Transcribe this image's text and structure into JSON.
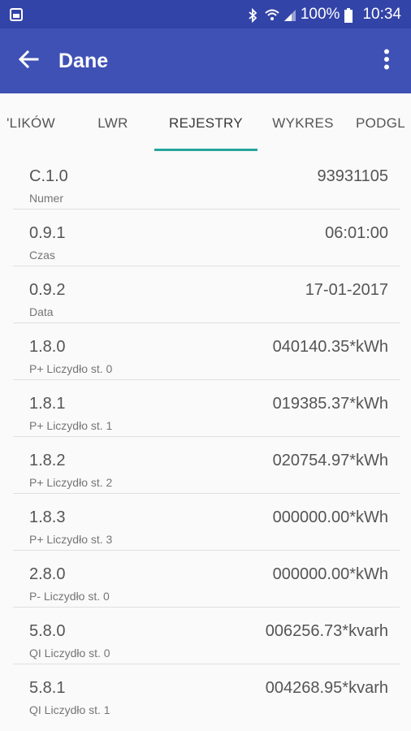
{
  "status_bar": {
    "battery_text": "100%",
    "time": "10:34"
  },
  "app_bar": {
    "title": "Dane",
    "back_icon": "arrow-back-icon",
    "menu_icon": "more-vert-icon"
  },
  "tabs": [
    {
      "label": "PLIKÓW",
      "visible_text": "'LIKÓW",
      "active": false
    },
    {
      "label": "LWR",
      "visible_text": "LWR",
      "active": false
    },
    {
      "label": "REJESTRY",
      "visible_text": "REJESTRY",
      "active": true
    },
    {
      "label": "WYKRES",
      "visible_text": "WYKRES",
      "active": false
    },
    {
      "label": "PODGLĄD",
      "visible_text": "PODGL",
      "active": false
    }
  ],
  "colors": {
    "primary": "#3f51b5",
    "status_bar": "#3344a8",
    "tab_indicator": "#26a69a"
  },
  "registers": [
    {
      "code": "C.1.0",
      "description": "Numer",
      "value": "93931105"
    },
    {
      "code": "0.9.1",
      "description": "Czas",
      "value": "06:01:00"
    },
    {
      "code": "0.9.2",
      "description": "Data",
      "value": "17-01-2017"
    },
    {
      "code": "1.8.0",
      "description": "P+ Liczydło st. 0",
      "value": "040140.35*kWh"
    },
    {
      "code": "1.8.1",
      "description": "P+ Liczydło st. 1",
      "value": "019385.37*kWh"
    },
    {
      "code": "1.8.2",
      "description": "P+ Liczydło st. 2",
      "value": "020754.97*kWh"
    },
    {
      "code": "1.8.3",
      "description": "P+ Liczydło st. 3",
      "value": "000000.00*kWh"
    },
    {
      "code": "2.8.0",
      "description": "P- Liczydło st. 0",
      "value": "000000.00*kWh"
    },
    {
      "code": "5.8.0",
      "description": "QI Liczydło st. 0",
      "value": "006256.73*kvarh"
    },
    {
      "code": "5.8.1",
      "description": "QI Liczydło st. 1",
      "value": "004268.95*kvarh"
    }
  ]
}
